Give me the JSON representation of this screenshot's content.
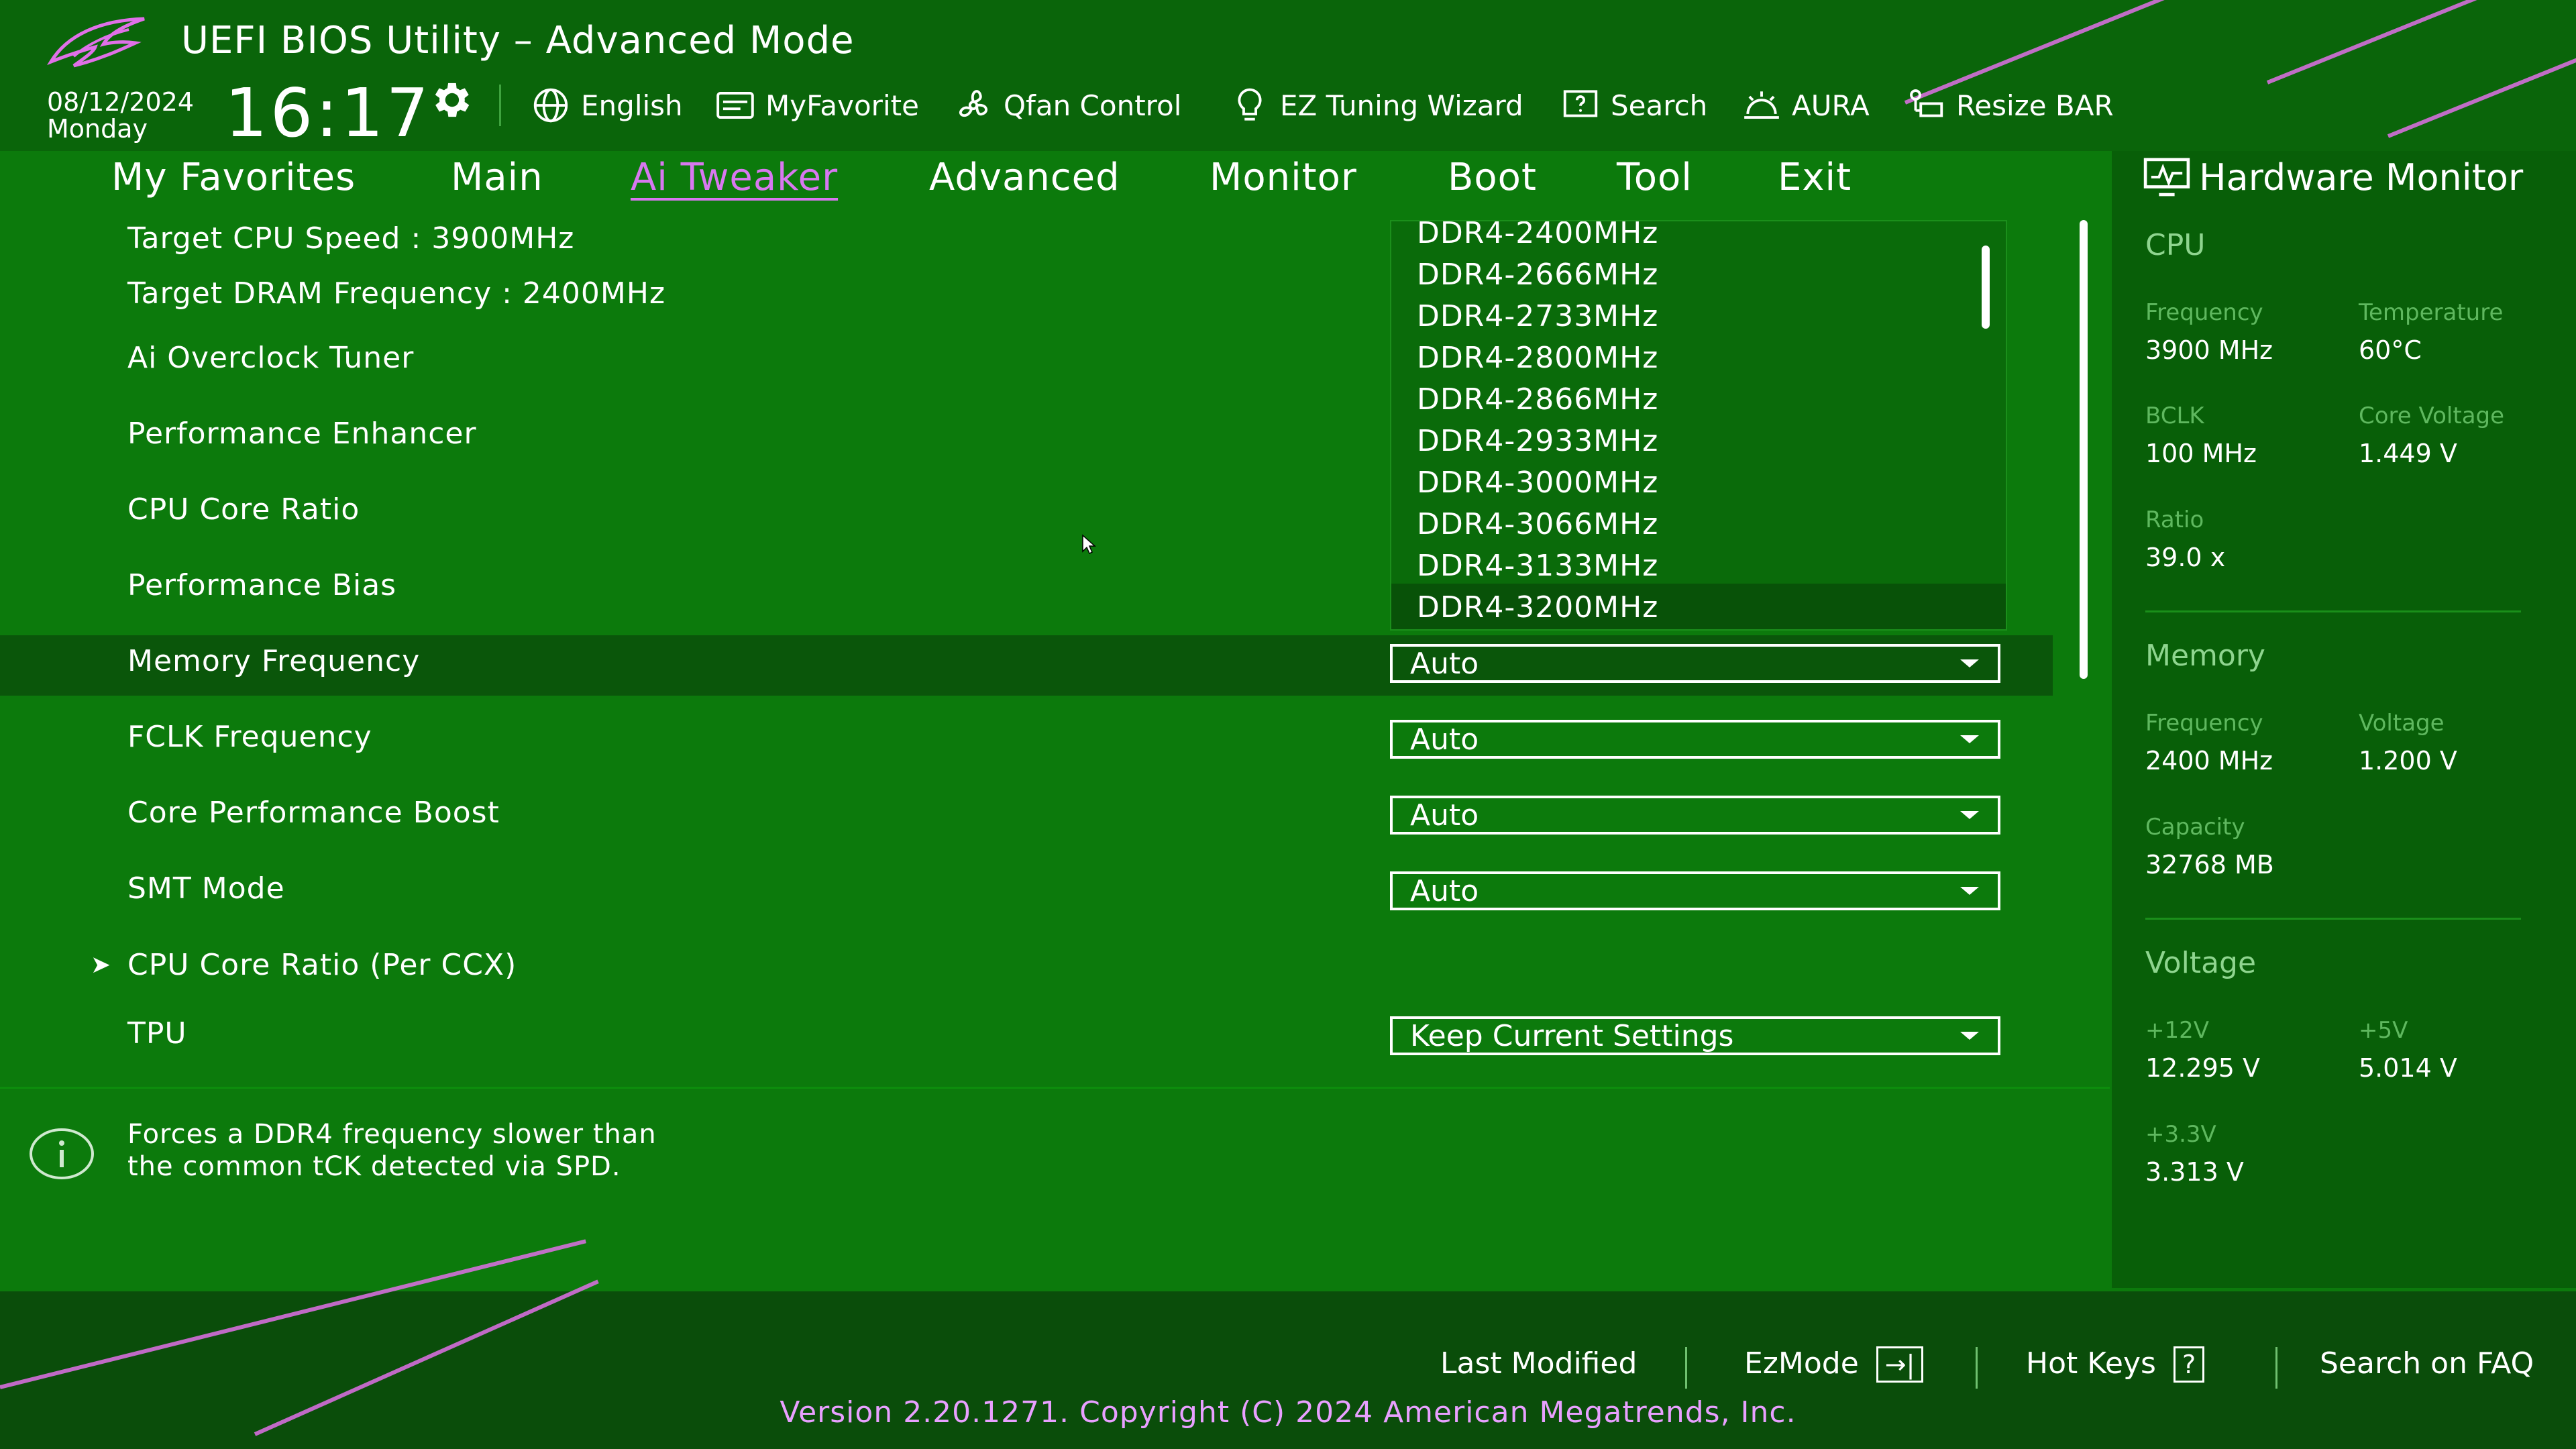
{
  "header": {
    "title": "UEFI BIOS Utility – Advanced Mode",
    "date": "08/12/2024",
    "weekday": "Monday",
    "time": "16:17",
    "toolbar": [
      {
        "label": "English",
        "icon": "globe-icon"
      },
      {
        "label": "MyFavorite",
        "icon": "my-favorite-icon"
      },
      {
        "label": "Qfan Control",
        "icon": "fan-icon"
      },
      {
        "label": "EZ Tuning Wizard",
        "icon": "lightbulb-icon"
      },
      {
        "label": "Search",
        "icon": "search-question-icon"
      },
      {
        "label": "AURA",
        "icon": "aura-icon"
      },
      {
        "label": "Resize BAR",
        "icon": "resize-bar-icon"
      }
    ]
  },
  "nav": {
    "tabs": [
      "My Favorites",
      "Main",
      "Ai Tweaker",
      "Advanced",
      "Monitor",
      "Boot",
      "Tool",
      "Exit"
    ],
    "active": "Ai Tweaker"
  },
  "settings": {
    "target_cpu_speed": "Target CPU Speed : 3900MHz",
    "target_dram_frequency": "Target DRAM Frequency : 2400MHz",
    "rows": [
      {
        "label": "Ai Overclock Tuner"
      },
      {
        "label": "Performance Enhancer"
      },
      {
        "label": "CPU Core Ratio"
      },
      {
        "label": "Performance Bias"
      },
      {
        "label": "Memory Frequency",
        "value": "Auto"
      },
      {
        "label": "FCLK Frequency",
        "value": "Auto"
      },
      {
        "label": "Core Performance Boost",
        "value": "Auto"
      },
      {
        "label": "SMT Mode",
        "value": "Auto"
      },
      {
        "label": "CPU Core Ratio (Per CCX)",
        "submenu_marker": "➤"
      },
      {
        "label": "TPU",
        "value": "Keep Current Settings"
      }
    ]
  },
  "dropdown_options": [
    "DDR4-2400MHz",
    "DDR4-2666MHz",
    "DDR4-2733MHz",
    "DDR4-2800MHz",
    "DDR4-2866MHz",
    "DDR4-2933MHz",
    "DDR4-3000MHz",
    "DDR4-3066MHz",
    "DDR4-3133MHz",
    "DDR4-3200MHz"
  ],
  "dropdown_highlighted": "DDR4-3200MHz",
  "help": {
    "icon": "info-icon",
    "line1": "Forces a DDR4 frequency slower than",
    "line2": "the common tCK detected via SPD."
  },
  "hardware_monitor": {
    "title": "Hardware Monitor",
    "cpu": {
      "section": "CPU",
      "frequency_label": "Frequency",
      "frequency": "3900 MHz",
      "temperature_label": "Temperature",
      "temperature": "60°C",
      "bclk_label": "BCLK",
      "bclk": "100 MHz",
      "core_voltage_label": "Core Voltage",
      "core_voltage": "1.449 V",
      "ratio_label": "Ratio",
      "ratio": "39.0 x"
    },
    "memory": {
      "section": "Memory",
      "frequency_label": "Frequency",
      "frequency": "2400 MHz",
      "voltage_label": "Voltage",
      "voltage": "1.200 V",
      "capacity_label": "Capacity",
      "capacity": "32768 MB"
    },
    "voltage": {
      "section": "Voltage",
      "v12_label": "+12V",
      "v12": "12.295 V",
      "v5_label": "+5V",
      "v5": "5.014 V",
      "v33_label": "+3.3V",
      "v33": "3.313 V"
    }
  },
  "footer": {
    "last_modified": "Last Modified",
    "ezmode": "EzMode",
    "ezmode_icon": "→|",
    "hot_keys": "Hot Keys",
    "hot_keys_icon": "?",
    "search_faq": "Search on FAQ",
    "version": "Version 2.20.1271. Copyright (C) 2024 American Megatrends, Inc."
  },
  "colors": {
    "background": "#0c7a0c",
    "accent": "#d878f0",
    "version_text": "#e8a0ff"
  }
}
